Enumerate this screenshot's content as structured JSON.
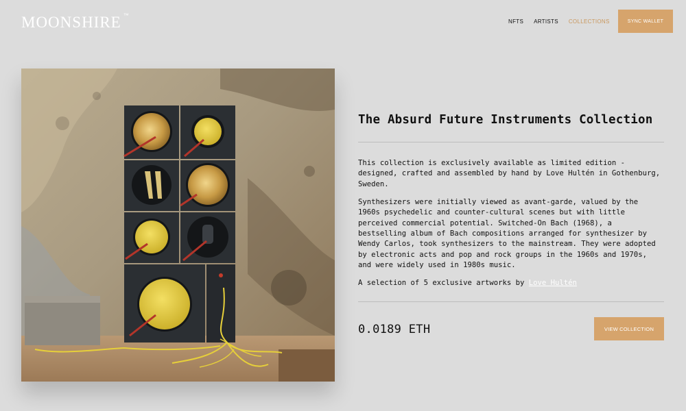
{
  "header": {
    "logo": "MOONSHIRE",
    "logo_mark": "™",
    "nav": [
      {
        "label": "NFTS",
        "active": false
      },
      {
        "label": "ARTISTS",
        "active": false
      },
      {
        "label": "COLLECTIONS",
        "active": true
      }
    ],
    "sync_wallet_label": "SYNC WALLET"
  },
  "collection": {
    "title": "The Absurd Future Instruments Collection",
    "paragraph_1": "This collection is exclusively available as limited edition - designed, crafted and assembled by hand by Love Hultén in Gothenburg, Sweden.",
    "paragraph_2": "Synthesizers were initially viewed as avant-garde, valued by the 1960s psychedelic and counter-cultural scenes but with little perceived commercial potential. Switched-On Bach (1968), a bestselling album of Bach compositions arranged for synthesizer by Wendy Carlos, took synthesizers to the mainstream. They were adopted by electronic acts and pop and rock groups in the 1960s and 1970s, and were widely used in 1980s music.",
    "selection_text": "A selection of 5 exclusive artworks by",
    "artist_name": "Love Hultén",
    "price": "0.0189 ETH",
    "view_collection_label": "VIEW COLLECTION"
  },
  "colors": {
    "accent": "#d6a46c",
    "active_nav": "#c9975c",
    "background": "#dcdcdc"
  }
}
